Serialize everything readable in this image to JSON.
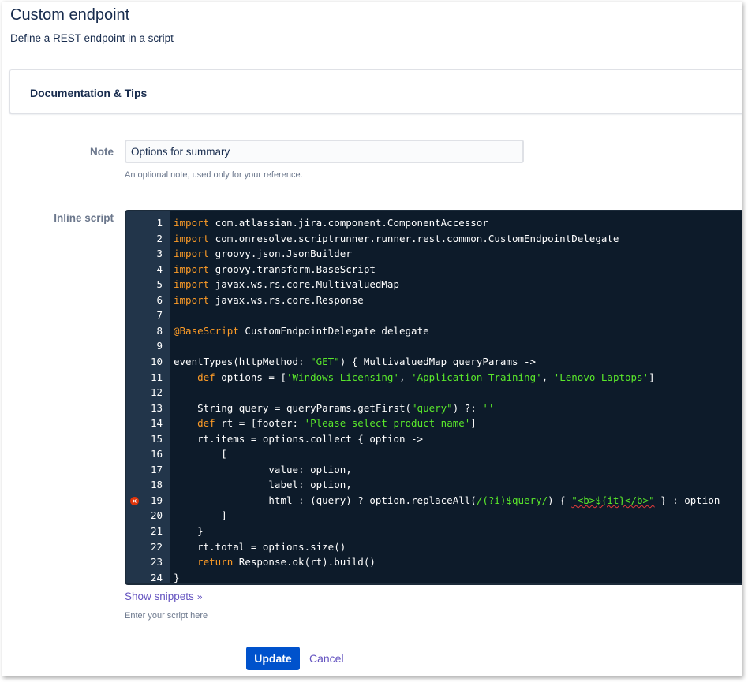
{
  "page": {
    "title": "Custom endpoint",
    "subtitle": "Define a REST endpoint in a script"
  },
  "documentation": {
    "title": "Documentation & Tips"
  },
  "note": {
    "label": "Note",
    "value": "Options for summary",
    "help": "An optional note, used only for your reference."
  },
  "inline_script": {
    "label": "Inline script",
    "error_line": 19,
    "lines": [
      "import com.atlassian.jira.component.ComponentAccessor",
      "import com.onresolve.scriptrunner.runner.rest.common.CustomEndpointDelegate",
      "import groovy.json.JsonBuilder",
      "import groovy.transform.BaseScript",
      "import javax.ws.rs.core.MultivaluedMap",
      "import javax.ws.rs.core.Response",
      "",
      "@BaseScript CustomEndpointDelegate delegate",
      "",
      "eventTypes(httpMethod: \"GET\") { MultivaluedMap queryParams ->",
      "    def options = ['Windows Licensing', 'Application Training', 'Lenovo Laptops']",
      "",
      "    String query = queryParams.getFirst(\"query\") ?: ''",
      "    def rt = [footer: 'Please select product name']",
      "    rt.items = options.collect { option ->",
      "        [",
      "                value: option,",
      "                label: option,",
      "                html : (query) ? option.replaceAll(/(?i)$query/) { \"<b>${it}</b>\" } : option",
      "        ]",
      "    }",
      "    rt.total = options.size()",
      "    return Response.ok(rt).build()",
      "}"
    ],
    "show_snippets": "Show snippets",
    "help": "Enter your script here"
  },
  "actions": {
    "update": "Update",
    "cancel": "Cancel"
  },
  "colors": {
    "editor_bg": "#0d1b2a",
    "gutter_bg": "#22354a",
    "keyword": "#fc9b27",
    "string": "#5ae82b",
    "primary": "#0052cc",
    "link": "#6554c0"
  },
  "icons": {
    "error": "error-circle-icon",
    "snippets_toggle": "double-chevron-down-icon"
  }
}
